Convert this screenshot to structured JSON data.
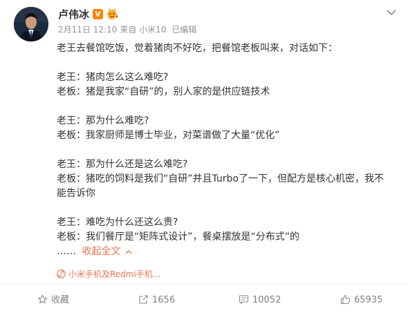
{
  "post": {
    "author": "卢伟冰",
    "verified_badge": "V",
    "date": "2月11日 12:10",
    "from_prefix": "来自",
    "device": "小米10",
    "edited": "已编辑"
  },
  "content": {
    "intro": "老王去餐馆吃饭，觉着猪肉不好吃，把餐馆老板叫来，对话如下：",
    "blocks": [
      [
        "老王：猪肉怎么这么难吃?",
        "老板：猪是我家“自研”的，别人家的是供应链技术"
      ],
      [
        "老王：那为什么难吃?",
        "老板：我家厨师是博士毕业，对菜谱做了大量“优化”"
      ],
      [
        "老王：那为什么还是这么难吃?",
        "老板：猪吃的饲料是我们“自研”并且Turbo了一下，但配方是核心机密，我不能告诉你"
      ],
      [
        "老王：难吃为什么还这么贵?",
        "老板：我们餐厅是“矩阵式设计”，餐桌摆放是“分布式”的"
      ]
    ],
    "ellipsis": "……",
    "collapse_label": "收起全文"
  },
  "source": {
    "label": "小米手机及Redmi手机..."
  },
  "actions": {
    "favorite_label": "收藏",
    "repost_count": "1656",
    "comment_count": "10052",
    "like_count": "65935"
  },
  "colors": {
    "accent": "#eb7350",
    "verified": "#ff8200",
    "meta_gray": "#939393",
    "text": "#333333"
  }
}
